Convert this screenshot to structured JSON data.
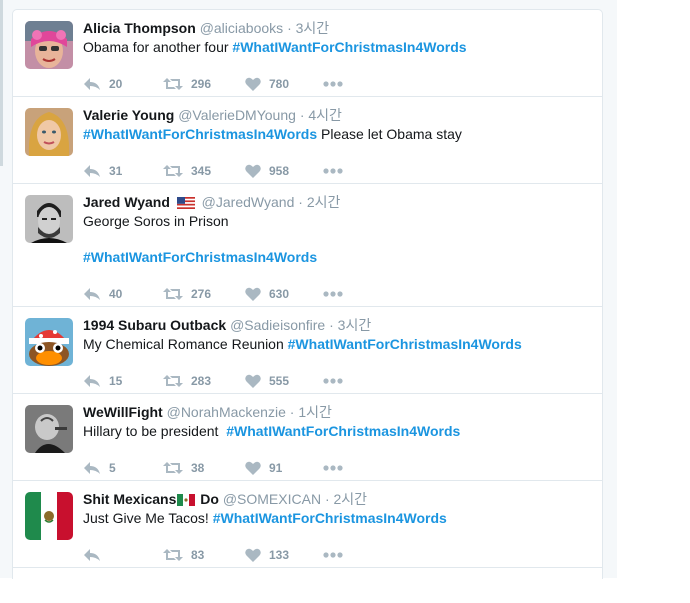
{
  "tweets": [
    {
      "fullname": "Alicia Thompson",
      "username": "@aliciabooks",
      "time": "3시간",
      "text_before": "Obama for another four ",
      "hashtag": "#WhatIWantForChristmasIn4Words",
      "text_after": "",
      "replies": "20",
      "retweets": "296",
      "likes": "780"
    },
    {
      "fullname": "Valerie Young",
      "username": "@ValerieDMYoung",
      "time": "4시간",
      "text_before": "",
      "hashtag": "#WhatIWantForChristmasIn4Words",
      "text_after": " Please let Obama stay",
      "replies": "31",
      "retweets": "345",
      "likes": "958"
    },
    {
      "fullname": "Jared Wyand",
      "flag": "us-flag-icon",
      "username": "@JaredWyand",
      "time": "2시간",
      "text_line1": "George Soros in Prison",
      "hashtag": "#WhatIWantForChristmasIn4Words",
      "replies": "40",
      "retweets": "276",
      "likes": "630"
    },
    {
      "fullname": "1994 Subaru Outback",
      "username": "@Sadieisonfire",
      "time": "3시간",
      "text_before": "My Chemical Romance Reunion ",
      "hashtag": "#WhatIWantForChristmasIn4Words",
      "text_after": "",
      "replies": "15",
      "retweets": "283",
      "likes": "555"
    },
    {
      "fullname": "WeWillFight",
      "username": "@NorahMackenzie",
      "time": "1시간",
      "text_before": "Hillary to be president  ",
      "hashtag": "#WhatIWantForChristmasIn4Words",
      "text_after": "",
      "replies": "5",
      "retweets": "38",
      "likes": "91"
    },
    {
      "fullname_part1": "Shit Mexicans",
      "flag": "mexico-flag-icon",
      "fullname_part2": " Do",
      "username": "@SOMEXICAN",
      "time": "2시간",
      "text_before": "Just Give Me Tacos! ",
      "hashtag": "#WhatIWantForChristmasIn4Words",
      "text_after": "",
      "replies": "",
      "retweets": "83",
      "likes": "133"
    }
  ],
  "separator": "·",
  "colors": {
    "link": "#1b95e0",
    "secondary": "#8899a6",
    "text": "#14171a",
    "border": "#e1e8ed",
    "icon": "#aab8c2"
  }
}
